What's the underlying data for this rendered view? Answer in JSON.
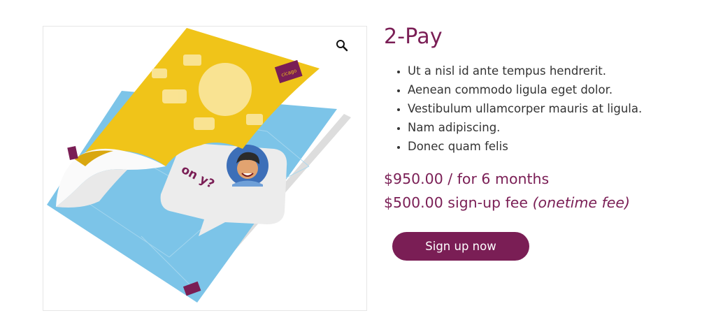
{
  "product": {
    "title": "2-Pay",
    "features": [
      "Ut a nisl id ante tempus hendrerit.",
      "Aenean commodo ligula eget dolor.",
      "Vestibulum ullamcorper mauris at ligula.",
      "Nam adipiscing.",
      "Donec quam felis"
    ],
    "price_main": "$950.00 / for 6 months",
    "signup_fee_amount": "$500.00 sign-up fee",
    "signup_fee_note": "(onetime fee)",
    "signup_button_label": "Sign up now"
  },
  "image": {
    "zoom_icon": "magnifier-icon",
    "brochure_text": "on y?",
    "badge_text": "cicago"
  },
  "colors": {
    "brand": "#7a1e55",
    "brochure_yellow": "#f0c419",
    "brochure_blue": "#7cc4e8"
  }
}
